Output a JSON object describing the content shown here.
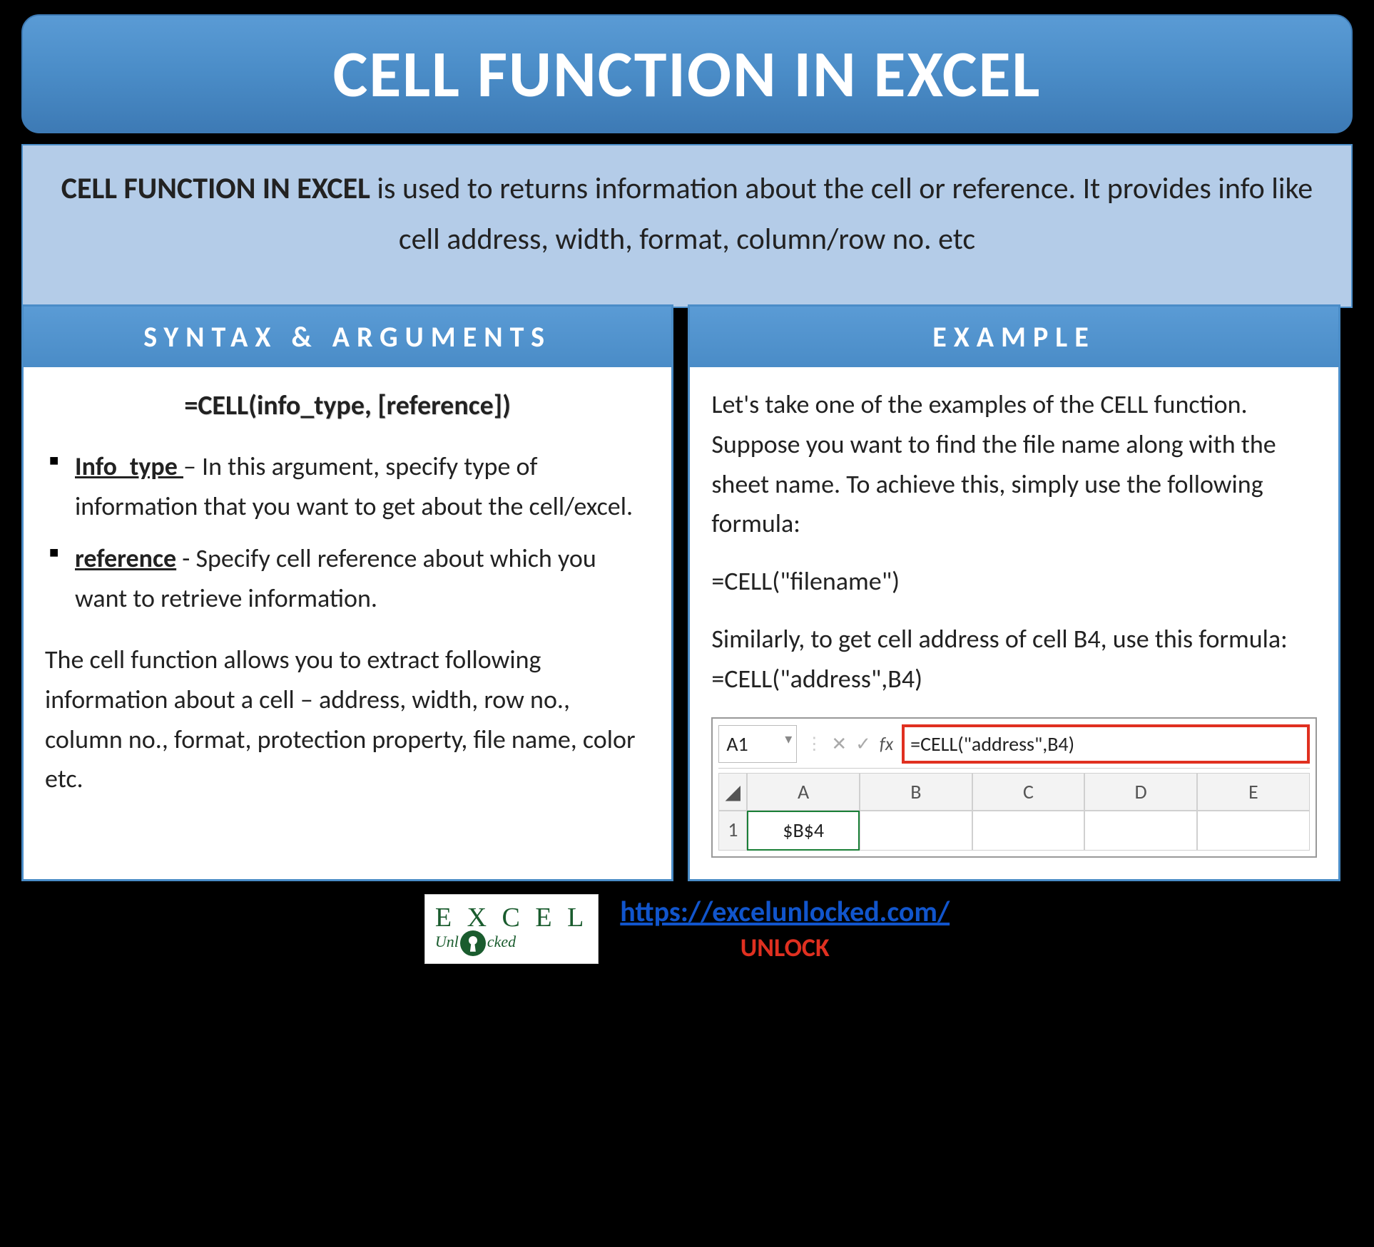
{
  "title": "CELL FUNCTION IN EXCEL",
  "description": {
    "lead": "CELL FUNCTION IN EXCEL",
    "rest": " is used to returns information about the cell or reference. It provides info like cell address, width, format, column/row no. etc"
  },
  "left": {
    "header": "SYNTAX & ARGUMENTS",
    "syntax": "=CELL(info_type, [reference])",
    "args": [
      {
        "name": "Info_type ",
        "desc": "– In this argument, specify type of information that you want to get about the cell/excel."
      },
      {
        "name": "reference",
        "desc": " - Specify cell reference about which you want to retrieve information."
      }
    ],
    "note": "The cell function allows you to extract following information about a cell – address, width, row no., column no., format, protection property, file name, color etc."
  },
  "right": {
    "header": "EXAMPLE",
    "p1": "Let's take one of the examples of the CELL function. Suppose you want to find the file name along with the sheet name. To achieve this, simply use the following formula:",
    "p2": "=CELL(\"filename\")",
    "p3": "Similarly, to get cell address of cell B4, use this formula: =CELL(\"address\",B4)",
    "excel": {
      "namebox": "A1",
      "fx_label": "fx",
      "formula": "=CELL(\"address\",B4)",
      "cols": [
        "A",
        "B",
        "C",
        "D",
        "E"
      ],
      "row1_label": "1",
      "a1_value": "$B$4"
    }
  },
  "footer": {
    "logo_top": "E X C E L",
    "logo_sub": "Unl   cked",
    "url": "https://excelunlocked.com/",
    "unlock": "UNLOCK"
  }
}
